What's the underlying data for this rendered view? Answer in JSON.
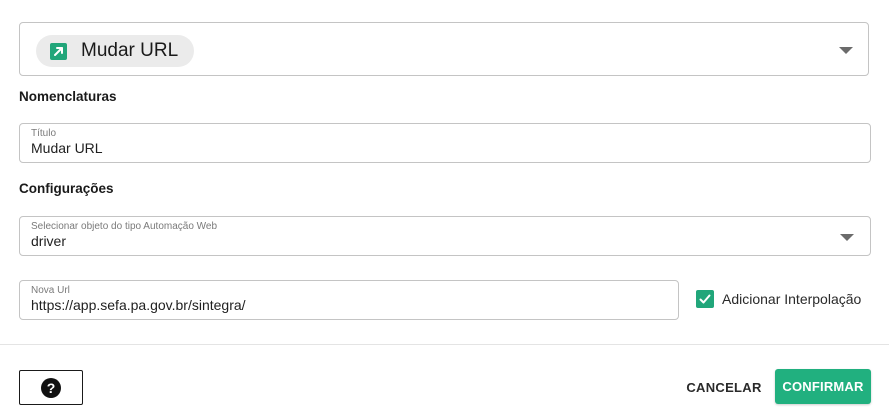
{
  "action_selector": {
    "chip_label": "Mudar URL",
    "chip_icon": "open-in-new-icon",
    "accent_color": "#21a67a"
  },
  "sections": {
    "nomenclaturas": "Nomenclaturas",
    "configuracoes": "Configurações"
  },
  "titulo_field": {
    "label": "Título",
    "value": "Mudar URL"
  },
  "automation_select": {
    "label": "Selecionar objeto do tipo Automação Web",
    "value": "driver"
  },
  "url_field": {
    "label": "Nova Url",
    "value": "https://app.sefa.pa.gov.br/sintegra/"
  },
  "interpolation_checkbox": {
    "label": "Adicionar Interpolação",
    "checked": true
  },
  "footer": {
    "help_icon": "?",
    "cancel_label": "CANCELAR",
    "confirm_label": "CONFIRMAR",
    "confirm_color": "#21b07f"
  }
}
